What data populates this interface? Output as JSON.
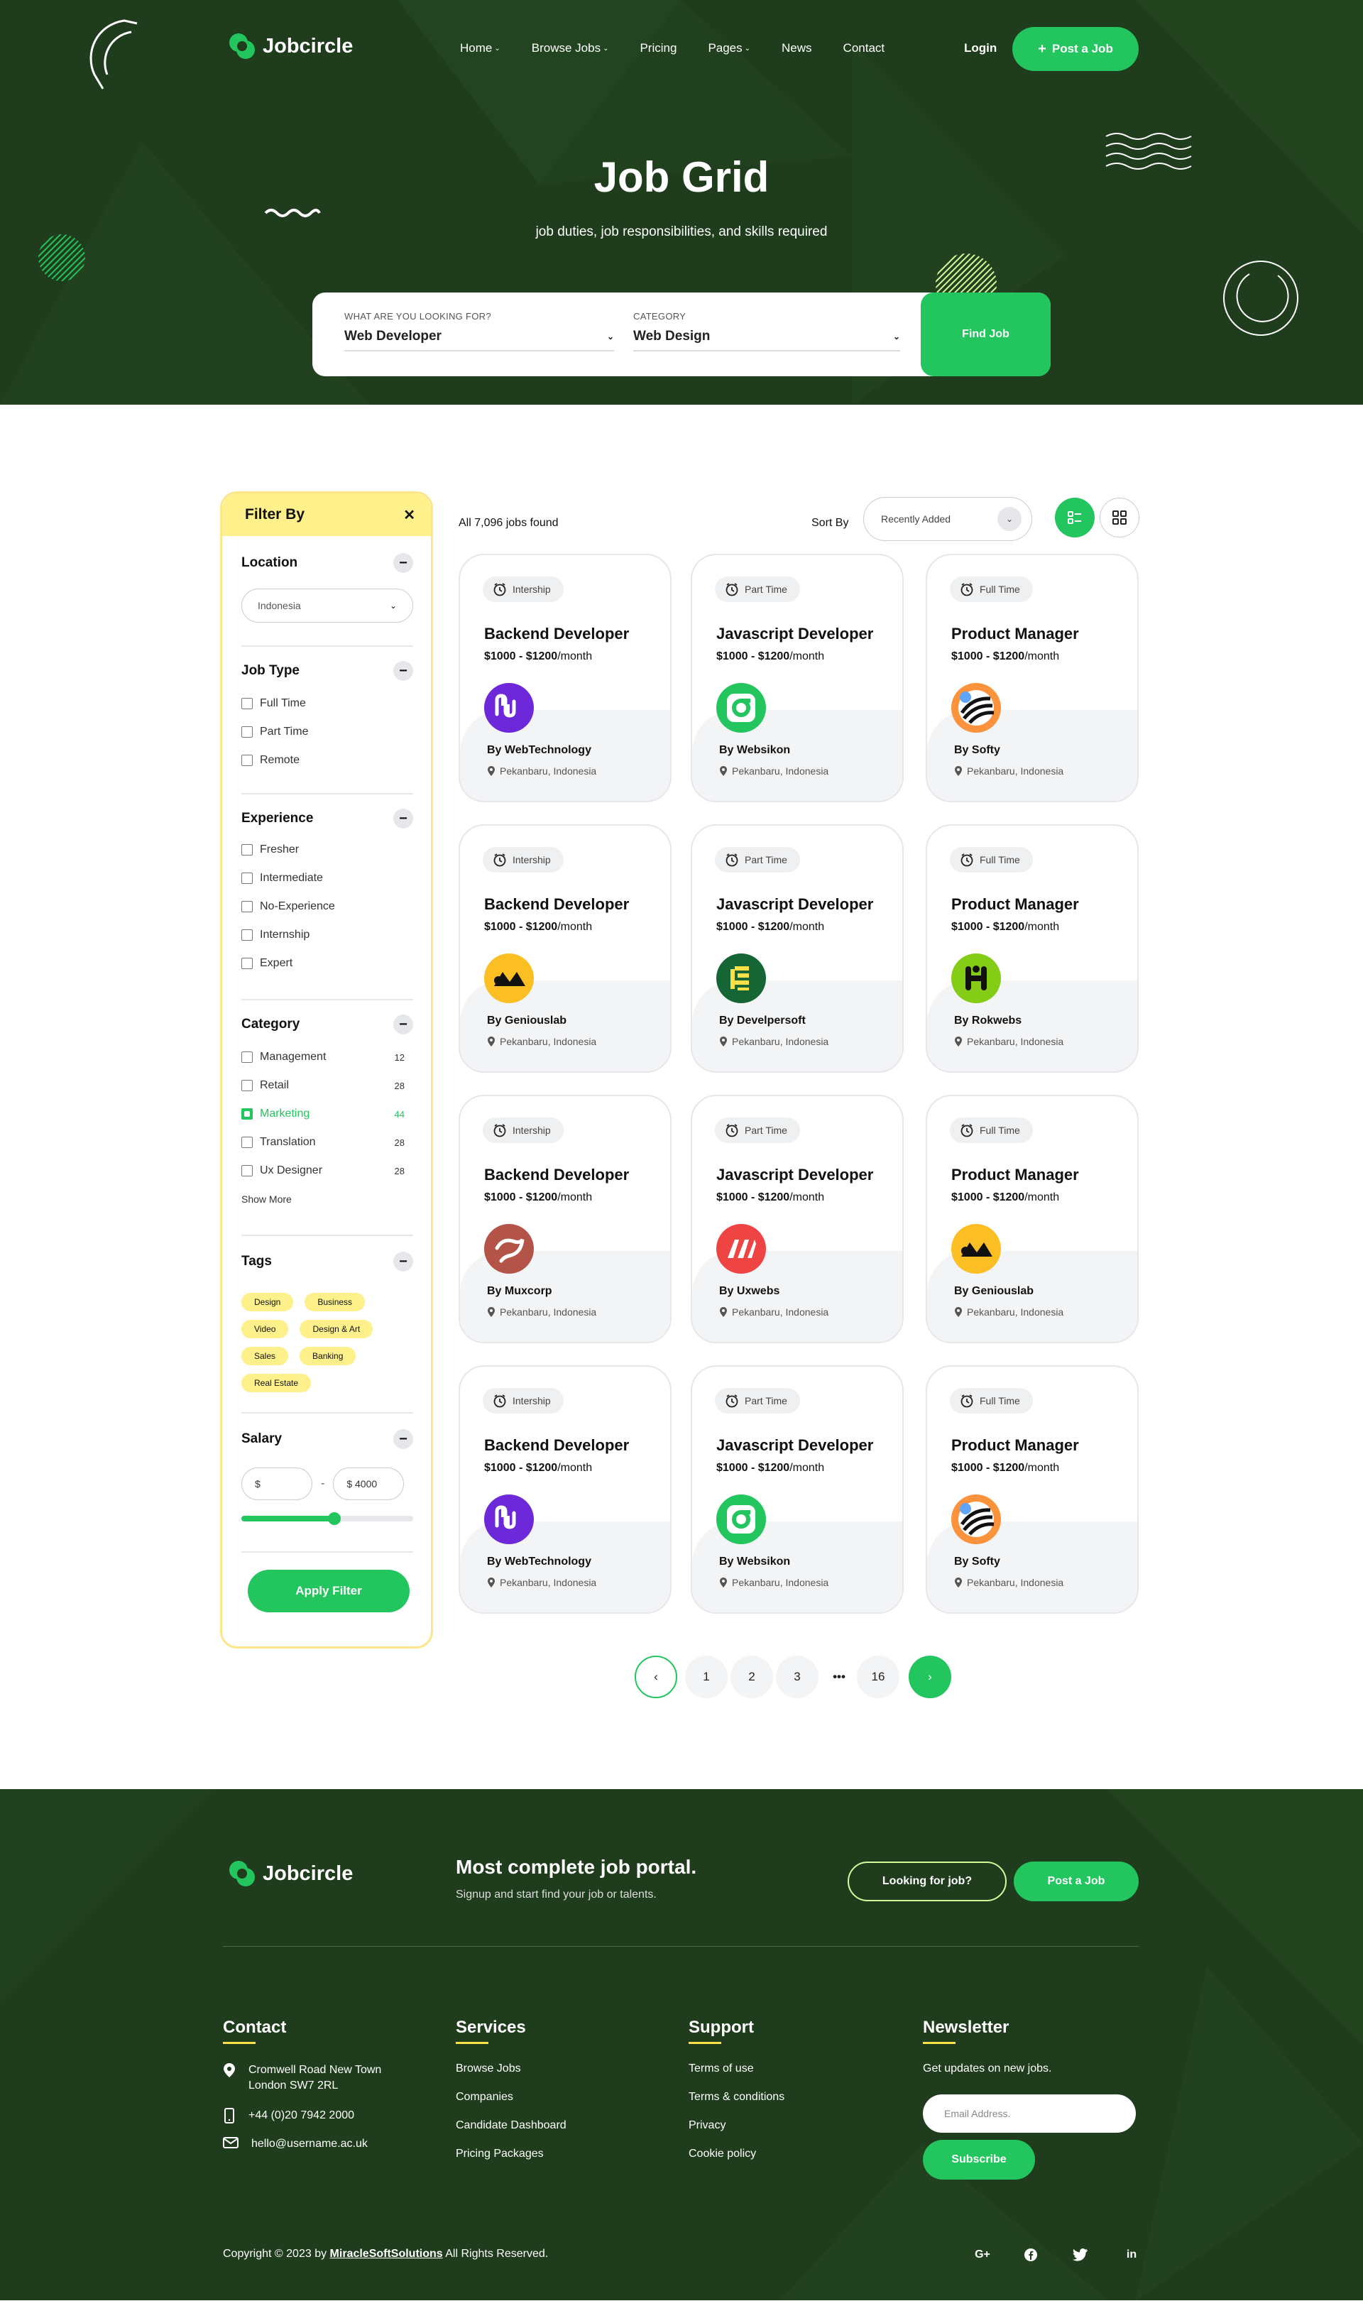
{
  "brand": {
    "name": "Jobcircle"
  },
  "nav": {
    "links": [
      "Home",
      "Browse Jobs",
      "Pricing",
      "Pages",
      "News",
      "Contact"
    ],
    "login": "Login",
    "post_job": "Post a Job"
  },
  "hero": {
    "title": "Job Grid",
    "subtitle": "job duties, job responsibilities, and skills required",
    "search": {
      "what_label": "WHAT ARE YOU LOOKING FOR?",
      "what_value": "Web Developer",
      "category_label": "CATEGORY",
      "category_value": "Web Design",
      "button": "Find Job"
    }
  },
  "filter": {
    "title": "Filter By",
    "location": {
      "title": "Location",
      "value": "Indonesia"
    },
    "job_type": {
      "title": "Job Type",
      "options": [
        "Full Time",
        "Part Time",
        "Remote"
      ]
    },
    "experience": {
      "title": "Experience",
      "options": [
        "Fresher",
        "Intermediate",
        "No-Experience",
        "Internship",
        "Expert"
      ]
    },
    "category": {
      "title": "Category",
      "options": [
        {
          "label": "Management",
          "count": "12",
          "checked": false
        },
        {
          "label": "Retail",
          "count": "28",
          "checked": false
        },
        {
          "label": "Marketing",
          "count": "44",
          "checked": true
        },
        {
          "label": "Translation",
          "count": "28",
          "checked": false
        },
        {
          "label": "Ux Designer",
          "count": "28",
          "checked": false
        }
      ],
      "show_more": "Show More"
    },
    "tags": {
      "title": "Tags",
      "items": [
        "Design",
        "Business",
        "Video",
        "Design & Art",
        "Sales",
        "Banking",
        "Real Estate"
      ]
    },
    "salary": {
      "title": "Salary",
      "min": "$",
      "sep": "-",
      "max": "$ 4000",
      "level": 0.54
    },
    "apply": "Apply Filter"
  },
  "results": {
    "count": "All 7,096 jobs found",
    "sort_label": "Sort By",
    "sort_value": "Recently Added"
  },
  "jobs": [
    {
      "type": "Intership",
      "title": "Backend Developer",
      "salary": "$1000 - $1200",
      "per": "/month",
      "company": "By WebTechnology",
      "location": "Pekanbaru, Indonesia",
      "logo": "webtechnology-logo"
    },
    {
      "type": "Part Time",
      "title": "Javascript Developer",
      "salary": "$1000 - $1200",
      "per": "/month",
      "company": "By Websikon",
      "location": "Pekanbaru, Indonesia",
      "logo": "websikon-logo"
    },
    {
      "type": "Full Time",
      "title": "Product Manager",
      "salary": "$1000 - $1200",
      "per": "/month",
      "company": "By Softy",
      "location": "Pekanbaru, Indonesia",
      "logo": "softy-logo"
    },
    {
      "type": "Intership",
      "title": "Backend Developer",
      "salary": "$1000 - $1200",
      "per": "/month",
      "company": "By Geniouslab",
      "location": "Pekanbaru, Indonesia",
      "logo": "geniouslab-logo"
    },
    {
      "type": "Part Time",
      "title": "Javascript Developer",
      "salary": "$1000 - $1200",
      "per": "/month",
      "company": "By Develpersoft",
      "location": "Pekanbaru, Indonesia",
      "logo": "develpersoft-logo"
    },
    {
      "type": "Full Time",
      "title": "Product Manager",
      "salary": "$1000 - $1200",
      "per": "/month",
      "company": "By Rokwebs",
      "location": "Pekanbaru, Indonesia",
      "logo": "rokwebs-logo"
    },
    {
      "type": "Intership",
      "title": "Backend Developer",
      "salary": "$1000 - $1200",
      "per": "/month",
      "company": "By Muxcorp",
      "location": "Pekanbaru, Indonesia",
      "logo": "muxcorp-logo"
    },
    {
      "type": "Part Time",
      "title": "Javascript Developer",
      "salary": "$1000 - $1200",
      "per": "/month",
      "company": "By Uxwebs",
      "location": "Pekanbaru, Indonesia",
      "logo": "uxwebs-logo"
    },
    {
      "type": "Full Time",
      "title": "Product Manager",
      "salary": "$1000 - $1200",
      "per": "/month",
      "company": "By Geniouslab",
      "location": "Pekanbaru, Indonesia",
      "logo": "geniouslab-logo"
    },
    {
      "type": "Intership",
      "title": "Backend Developer",
      "salary": "$1000 - $1200",
      "per": "/month",
      "company": "By WebTechnology",
      "location": "Pekanbaru, Indonesia",
      "logo": "webtechnology-logo"
    },
    {
      "type": "Part Time",
      "title": "Javascript Developer",
      "salary": "$1000 - $1200",
      "per": "/month",
      "company": "By Websikon",
      "location": "Pekanbaru, Indonesia",
      "logo": "websikon-logo"
    },
    {
      "type": "Full Time",
      "title": "Product Manager",
      "salary": "$1000 - $1200",
      "per": "/month",
      "company": "By Softy",
      "location": "Pekanbaru, Indonesia",
      "logo": "softy-logo"
    }
  ],
  "pagination": {
    "pages": [
      "1",
      "2",
      "3",
      "•••",
      "16"
    ]
  },
  "footer": {
    "headline": "Most complete job portal.",
    "subline": "Signup and start find your job or talents.",
    "looking_btn": "Looking for job?",
    "post_btn": "Post a Job",
    "contact": {
      "title": "Contact",
      "address1": "Cromwell Road New Town",
      "address2": "London SW7 2RL",
      "phone": "+44 (0)20 7942 2000",
      "email": "hello@username.ac.uk"
    },
    "services": {
      "title": "Services",
      "items": [
        "Browse Jobs",
        "Companies",
        "Candidate Dashboard",
        "Pricing Packages"
      ]
    },
    "support": {
      "title": "Support",
      "items": [
        "Terms of use",
        "Terms & conditions",
        "Privacy",
        "Cookie policy"
      ]
    },
    "newsletter": {
      "title": "Newsletter",
      "text": "Get updates on new jobs.",
      "placeholder": "Email Address.",
      "button": "Subscribe"
    },
    "copyright_pre": "Copyright © 2023 by ",
    "copyright_brand": "MiracleSoftSolutions",
    "copyright_post": " All Rights Reserved.",
    "socials": [
      "google-plus-icon",
      "facebook-icon",
      "twitter-icon",
      "linkedin-icon"
    ]
  },
  "colors": {
    "primary": "#22c55e",
    "dark": "#1f3d1c",
    "accent_yellow": "#fef08a"
  }
}
